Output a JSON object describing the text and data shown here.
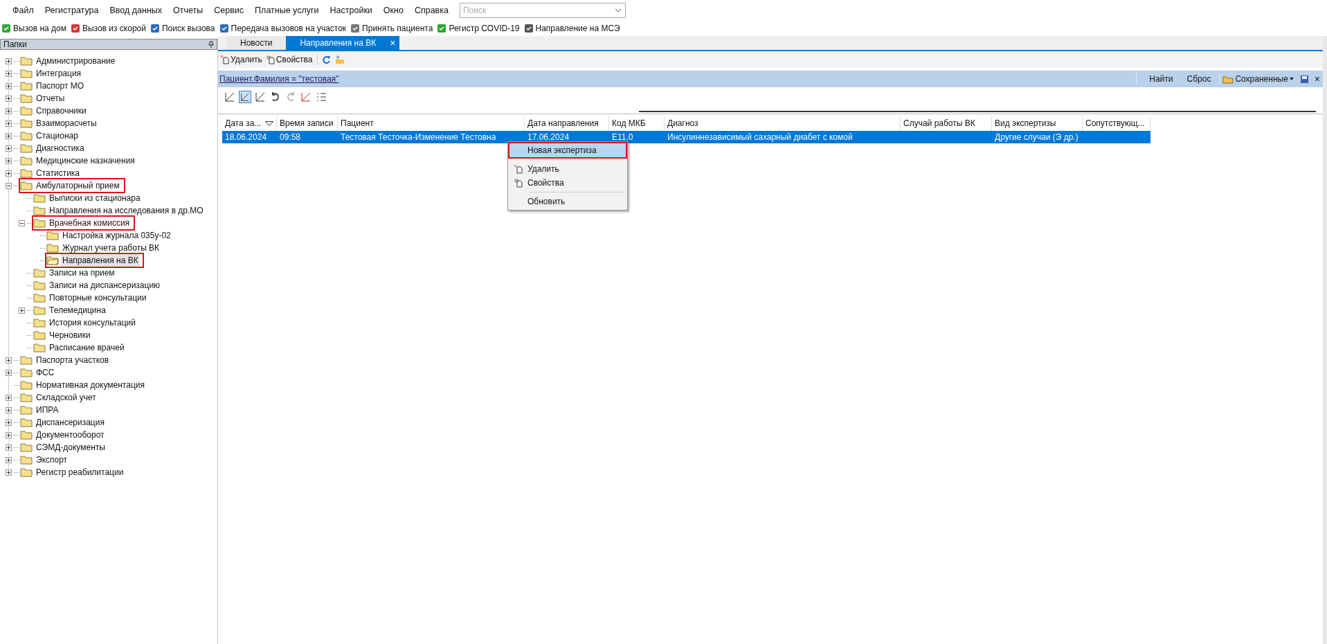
{
  "menu": [
    "Файл",
    "Регистратура",
    "Ввод данных",
    "Отчеты",
    "Сервис",
    "Платные услуги",
    "Настройки",
    "Окно",
    "Справка"
  ],
  "search": {
    "placeholder": "Поиск"
  },
  "toolbar": [
    "Вызов на дом",
    "Вызов из скорой",
    "Поиск вызова",
    "Передача вызовов на участок",
    "Принять пациента",
    "Регистр COVID-19",
    "Направление на МСЭ"
  ],
  "sidebar": {
    "title": "Папки",
    "tree": [
      {
        "label": "Администрирование",
        "expanded": false,
        "selected": false,
        "highlighted": false
      },
      {
        "label": "Интеграция",
        "expanded": false,
        "selected": false,
        "highlighted": false
      },
      {
        "label": "Паспорт МО",
        "expanded": false,
        "selected": false,
        "highlighted": false
      },
      {
        "label": "Отчеты",
        "expanded": false,
        "selected": false,
        "highlighted": false
      },
      {
        "label": "Справочники",
        "expanded": false,
        "selected": false,
        "highlighted": false
      },
      {
        "label": "Взаиморасчеты",
        "expanded": false,
        "selected": false,
        "highlighted": false
      },
      {
        "label": "Стационар",
        "expanded": false,
        "selected": false,
        "highlighted": false
      },
      {
        "label": "Диагностика",
        "expanded": false,
        "selected": false,
        "highlighted": false
      },
      {
        "label": "Медицинские назначения",
        "expanded": false,
        "selected": false,
        "highlighted": false
      },
      {
        "label": "Статистика",
        "expanded": false,
        "selected": false,
        "highlighted": false
      },
      {
        "label": "Амбулаторный прием",
        "expanded": true,
        "selected": false,
        "highlighted": true,
        "children": [
          {
            "label": "Выписки из стационара",
            "selected": false,
            "highlighted": false
          },
          {
            "label": "Направления на исследования в др.МО",
            "selected": false,
            "highlighted": false
          },
          {
            "label": "Врачебная комиссия",
            "expanded": true,
            "selected": false,
            "highlighted": true,
            "children": [
              {
                "label": "Настройка журнала 035у-02",
                "selected": false,
                "highlighted": false
              },
              {
                "label": "Журнал учета работы ВК",
                "selected": false,
                "highlighted": false
              },
              {
                "label": "Направления на ВК",
                "selected": true,
                "highlighted": true
              }
            ]
          },
          {
            "label": "Записи на прием",
            "selected": false,
            "highlighted": false
          },
          {
            "label": "Записи на диспансеризацию",
            "selected": false,
            "highlighted": false
          },
          {
            "label": "Повторные консультации",
            "selected": false,
            "highlighted": false
          },
          {
            "label": "Телемедицина",
            "expanded": false,
            "selected": false,
            "highlighted": false
          },
          {
            "label": "История консультаций",
            "selected": false,
            "highlighted": false
          },
          {
            "label": "Черновики",
            "selected": false,
            "highlighted": false
          },
          {
            "label": "Расписание врачей",
            "selected": false,
            "highlighted": false
          }
        ]
      },
      {
        "label": "Паспорта участков",
        "expanded": false,
        "selected": false,
        "highlighted": false
      },
      {
        "label": "ФСС",
        "expanded": false,
        "selected": false,
        "highlighted": false
      },
      {
        "label": "Нормативная документация",
        "selected": false,
        "highlighted": false
      },
      {
        "label": "Складской учет",
        "expanded": false,
        "selected": false,
        "highlighted": false
      },
      {
        "label": "ИПРА",
        "expanded": false,
        "selected": false,
        "highlighted": false
      },
      {
        "label": "Диспансеризация",
        "expanded": false,
        "selected": false,
        "highlighted": false
      },
      {
        "label": "Документооборот",
        "expanded": false,
        "selected": false,
        "highlighted": false
      },
      {
        "label": "СЭМД-документы",
        "expanded": false,
        "selected": false,
        "highlighted": false
      },
      {
        "label": "Экспорт",
        "expanded": false,
        "selected": false,
        "highlighted": false
      },
      {
        "label": "Регистр реабилитации",
        "expanded": false,
        "selected": false,
        "highlighted": false
      }
    ]
  },
  "tabs": [
    {
      "label": "Новости",
      "selected": false
    },
    {
      "label": "Направления на ВК",
      "selected": true,
      "close": "×"
    }
  ],
  "actions": [
    "Удалить",
    "Свойства"
  ],
  "filter": {
    "expression": "Пациент.Фамилия = \"тестовая\"",
    "buttons": [
      "Найти",
      "Сброс"
    ],
    "saved": "Сохраненные",
    "close": "×"
  },
  "table": {
    "columns": [
      "Дата за...",
      "Время записи",
      "Пациент",
      "Дата направления",
      "Код МКБ",
      "Диагноз",
      "Случай работы ВК",
      "Вид экспертизы",
      "Сопутствующ..."
    ],
    "rows": [
      {
        "selected": true,
        "cells": [
          "18.06.2024",
          "09:58",
          "Тестовая Тесточка-Изменение Тестовна",
          "17.06.2024",
          "E11.0",
          "Инсулиннезависимый сахарный диабет с комой",
          "",
          "Другие случаи (Э др.)",
          ""
        ]
      }
    ]
  },
  "context_menu": [
    {
      "kind": "item",
      "label": "Новая экспертиза",
      "highlighted": true
    },
    {
      "kind": "separator"
    },
    {
      "kind": "item",
      "label": "Удалить",
      "highlighted": false
    },
    {
      "kind": "item",
      "label": "Свойства",
      "highlighted": false
    },
    {
      "kind": "separator"
    },
    {
      "kind": "item",
      "label": "Обновить",
      "highlighted": false
    }
  ]
}
